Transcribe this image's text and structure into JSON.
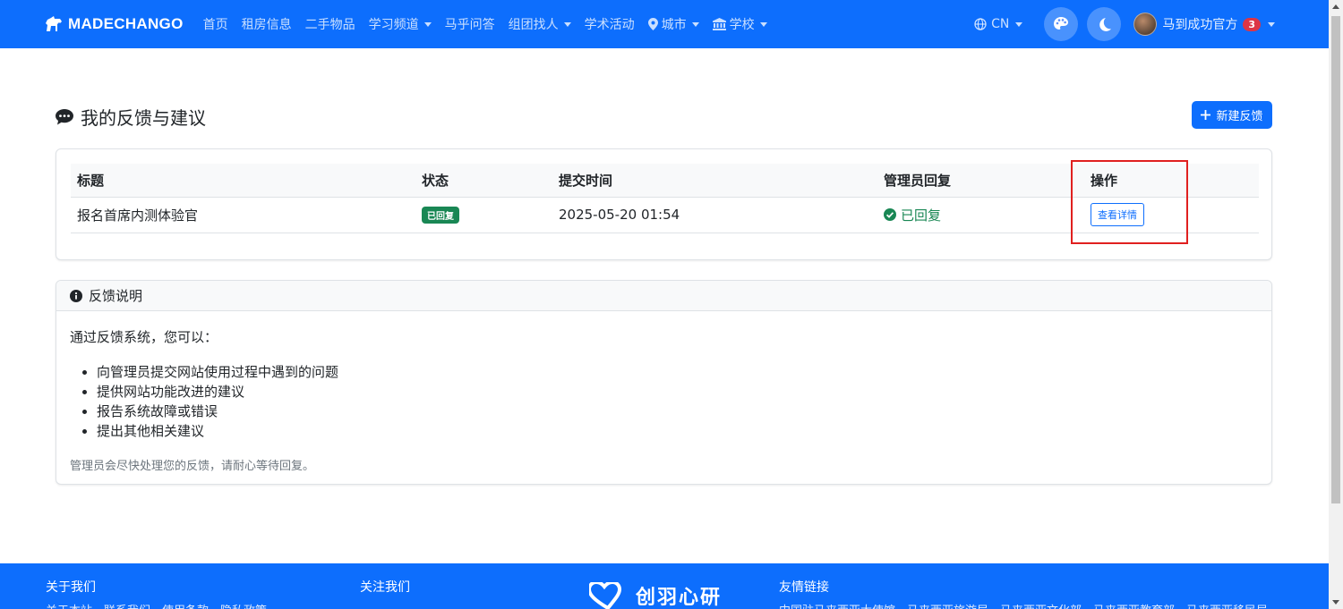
{
  "nav": {
    "brand": "MADECHANGO",
    "links": [
      {
        "label": "首页",
        "dropdown": false
      },
      {
        "label": "租房信息",
        "dropdown": false
      },
      {
        "label": "二手物品",
        "dropdown": false
      },
      {
        "label": "学习频道",
        "dropdown": true
      },
      {
        "label": "马乎问答",
        "dropdown": false
      },
      {
        "label": "组团找人",
        "dropdown": true
      },
      {
        "label": "学术活动",
        "dropdown": false
      },
      {
        "label": "城市",
        "dropdown": true,
        "icon": "map-pin-icon"
      },
      {
        "label": "学校",
        "dropdown": true,
        "icon": "university-icon"
      }
    ],
    "lang": "CN",
    "user_name": "马到成功官方",
    "notification_count": "3"
  },
  "page": {
    "title": "我的反馈与建议",
    "new_button": "新建反馈"
  },
  "table": {
    "headers": [
      "标题",
      "状态",
      "提交时间",
      "管理员回复",
      "操作"
    ],
    "rows": [
      {
        "title": "报名首席内测体验官",
        "status": "已回复",
        "submitted": "2025-05-20 01:54",
        "admin_reply": "已回复",
        "action": "查看详情"
      }
    ]
  },
  "info": {
    "header": "反馈说明",
    "intro": "通过反馈系统，您可以：",
    "items": [
      "向管理员提交网站使用过程中遇到的问题",
      "提供网站功能改进的建议",
      "报告系统故障或错误",
      "提出其他相关建议"
    ],
    "note": "管理员会尽快处理您的反馈，请耐心等待回复。"
  },
  "footer": {
    "about": "关于我们",
    "about_links": "关于本站　联系我们　使用条款　隐私政策",
    "follow": "关注我们",
    "logo_text": "创羽心研",
    "friends": "友情链接",
    "friend_links": "中国驻马来西亚大使馆　马来西亚旅游局　马来西亚文化部　马来西亚教育部　马来西亚移民局"
  },
  "colors": {
    "primary": "#0d6efd",
    "success": "#198754",
    "danger": "#dc3545",
    "highlight": "#e0201f"
  }
}
